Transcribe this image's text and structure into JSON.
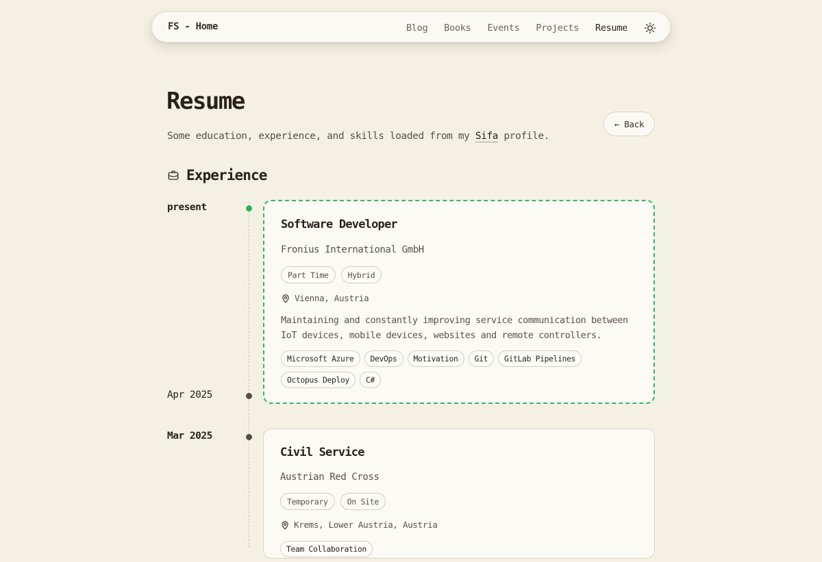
{
  "nav": {
    "home": "FS - Home",
    "links": [
      "Blog",
      "Books",
      "Events",
      "Projects",
      "Resume"
    ],
    "active": "Resume",
    "theme_icon": "sun-icon"
  },
  "page": {
    "title": "Resume",
    "subtitle_before": "Some education, experience, and skills loaded from my ",
    "subtitle_link": "Sifa",
    "subtitle_after": " profile.",
    "back_label": "← Back"
  },
  "experience": {
    "heading": "Experience",
    "icon": "briefcase-icon",
    "items": [
      {
        "date_start": "present",
        "date_end": "Apr 2025",
        "title": "Software Developer",
        "company": "Fronius International GmbH",
        "tags": [
          "Part Time",
          "Hybrid"
        ],
        "location": "Vienna, Austria",
        "description": "Maintaining and constantly improving service communication between IoT devices, mobile devices, websites and remote controllers.",
        "skills": [
          "Microsoft Azure",
          "DevOps",
          "Motivation",
          "Git",
          "GitLab Pipelines",
          "Octopus Deploy",
          "C#"
        ],
        "accent": "#34b463"
      },
      {
        "date_start": "Mar 2025",
        "title": "Civil Service",
        "company": "Austrian Red Cross",
        "tags": [
          "Temporary",
          "On Site"
        ],
        "location": "Krems, Lower Austria, Austria",
        "skills": [
          "Team Collaboration"
        ]
      }
    ]
  }
}
